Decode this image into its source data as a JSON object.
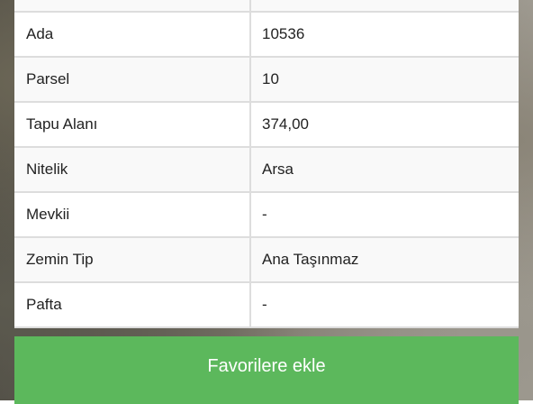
{
  "parcel_table": {
    "rows": [
      {
        "label": "Ada",
        "value": "10536"
      },
      {
        "label": "Parsel",
        "value": "10"
      },
      {
        "label": "Tapu Alanı",
        "value": "374,00"
      },
      {
        "label": "Nitelik",
        "value": "Arsa"
      },
      {
        "label": "Mevkii",
        "value": "-"
      },
      {
        "label": "Zemin Tip",
        "value": "Ana Taşınmaz"
      },
      {
        "label": "Pafta",
        "value": "-"
      }
    ]
  },
  "actions": {
    "favorite_label": "Favorilere ekle"
  },
  "colors": {
    "button_green": "#5cb85c",
    "border": "#dddddd",
    "stripe": "#f9f9f9"
  }
}
